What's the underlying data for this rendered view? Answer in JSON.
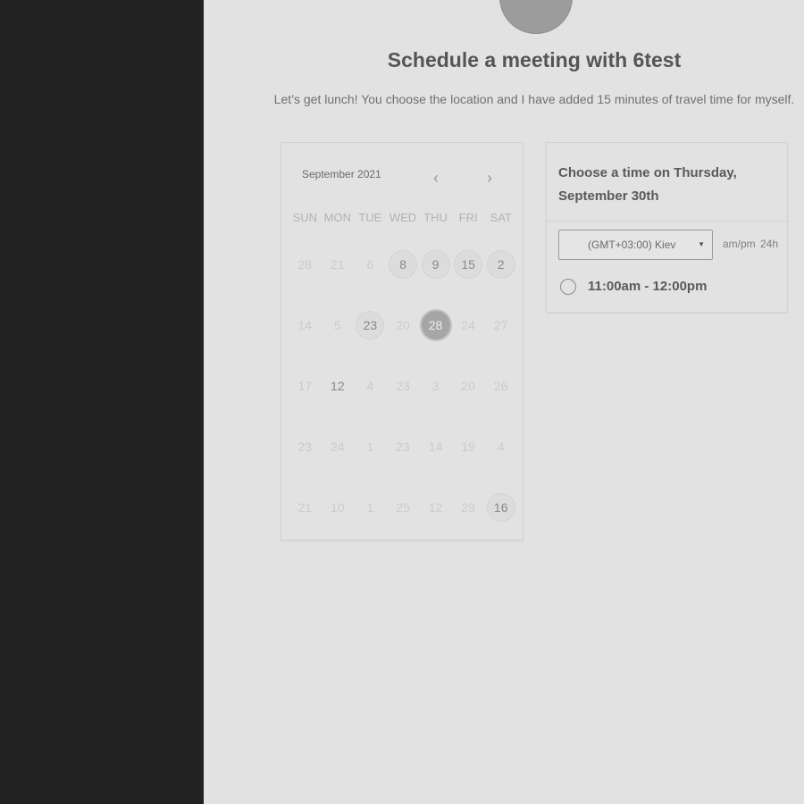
{
  "page": {
    "title": "Schedule a meeting with 6test",
    "description": "Let’s get lunch! You choose the location and I have added 15 minutes of travel time for myself."
  },
  "calendar": {
    "month_label": "September 2021",
    "prev_icon": "‹",
    "next_icon": "›",
    "weekdays": [
      "SUN",
      "MON",
      "TUE",
      "WED",
      "THU",
      "FRI",
      "SAT"
    ],
    "weeks": [
      [
        {
          "label": "28"
        },
        {
          "label": "21"
        },
        {
          "label": "6"
        },
        {
          "label": "8",
          "state": "available"
        },
        {
          "label": "9",
          "state": "available"
        },
        {
          "label": "15",
          "state": "available"
        },
        {
          "label": "2",
          "state": "available"
        }
      ],
      [
        {
          "label": "14"
        },
        {
          "label": "5"
        },
        {
          "label": "23",
          "state": "available"
        },
        {
          "label": "20"
        },
        {
          "label": "28",
          "state": "selected"
        },
        {
          "label": "24"
        },
        {
          "label": "27"
        }
      ],
      [
        {
          "label": "17"
        },
        {
          "label": "12",
          "state": "bold"
        },
        {
          "label": "4"
        },
        {
          "label": "23"
        },
        {
          "label": "3"
        },
        {
          "label": "20"
        },
        {
          "label": "26"
        }
      ],
      [
        {
          "label": "23"
        },
        {
          "label": "24"
        },
        {
          "label": "1"
        },
        {
          "label": "23"
        },
        {
          "label": "14"
        },
        {
          "label": "19"
        },
        {
          "label": "4"
        }
      ],
      [
        {
          "label": "21"
        },
        {
          "label": "10"
        },
        {
          "label": "1"
        },
        {
          "label": "25"
        },
        {
          "label": "12"
        },
        {
          "label": "29"
        },
        {
          "label": "16",
          "state": "available"
        }
      ]
    ]
  },
  "time_panel": {
    "heading": "Choose a time on Thursday, September 30th",
    "timezone": "(GMT+03:00) Kiev",
    "format_ampm": "am/pm",
    "format_24h": "24h",
    "slots": [
      "11:00am - 12:00pm"
    ]
  },
  "colors": {
    "sidebar": "#222222",
    "background": "#e2e2e2",
    "selected_day": "#a6a6a6"
  }
}
